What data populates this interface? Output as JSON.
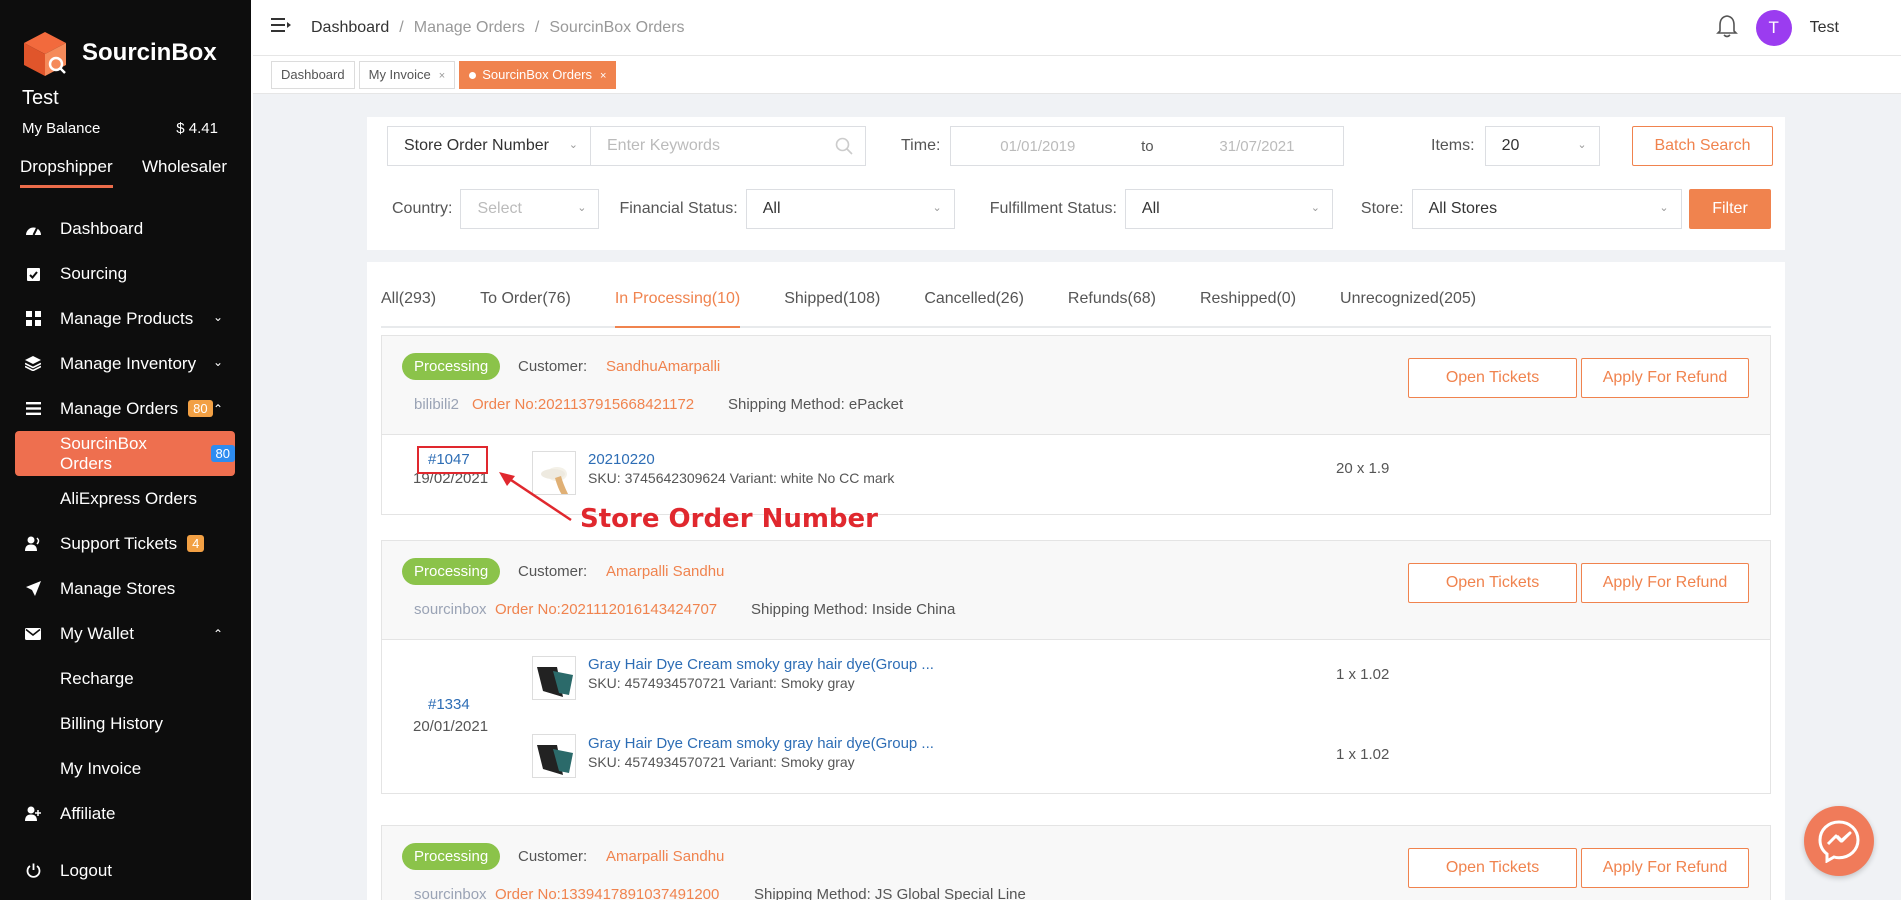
{
  "sidebar": {
    "brand": "SourcinBox",
    "user_name": "Test",
    "balance_label": "My Balance",
    "balance_value": "$ 4.41",
    "roles": [
      "Dropshipper",
      "Wholesaler"
    ],
    "items": [
      {
        "label": "Dashboard",
        "icon": "dashboard-icon"
      },
      {
        "label": "Sourcing",
        "icon": "sourcing-icon"
      },
      {
        "label": "Manage Products",
        "icon": "grid-icon"
      },
      {
        "label": "Manage Inventory",
        "icon": "layers-icon"
      },
      {
        "label": "Manage Orders",
        "icon": "list-icon",
        "badge": "80"
      },
      {
        "label": "SourcinBox Orders",
        "badge": "80"
      },
      {
        "label": "AliExpress Orders"
      },
      {
        "label": "Support Tickets",
        "icon": "support-icon",
        "badge": "4"
      },
      {
        "label": "Manage Stores",
        "icon": "send-icon"
      },
      {
        "label": "My Wallet",
        "icon": "mail-icon"
      },
      {
        "label": "Recharge"
      },
      {
        "label": "Billing History"
      },
      {
        "label": "My Invoice"
      },
      {
        "label": "Affiliate",
        "icon": "affiliate-icon"
      },
      {
        "label": "Logout",
        "icon": "power-icon"
      }
    ]
  },
  "header": {
    "breadcrumb": [
      "Dashboard",
      "Manage Orders",
      "SourcinBox Orders"
    ],
    "user": "Test",
    "avatar_letter": "T"
  },
  "page_tabs": [
    {
      "label": "Dashboard"
    },
    {
      "label": "My Invoice",
      "close": "×"
    },
    {
      "label": "SourcinBox Orders",
      "close": "×"
    }
  ],
  "filters": {
    "order_type": "Store Order Number",
    "keyword_placeholder": "Enter Keywords",
    "time_label": "Time:",
    "date_from": "01/01/2019",
    "date_to_label": "to",
    "date_to": "31/07/2021",
    "items_label": "Items:",
    "items_value": "20",
    "batch_search": "Batch Search",
    "country_label": "Country:",
    "country_placeholder": "Select",
    "financial_label": "Financial Status:",
    "financial_value": "All",
    "fulfillment_label": "Fulfillment Status:",
    "fulfillment_value": "All",
    "store_label": "Store:",
    "store_value": "All Stores",
    "filter_button": "Filter"
  },
  "status_tabs": [
    "All(293)",
    "To Order(76)",
    "In Processing(10)",
    "Shipped(108)",
    "Cancelled(26)",
    "Refunds(68)",
    "Reshipped(0)",
    "Unrecognized(205)"
  ],
  "orders": [
    {
      "status": "Processing",
      "customer_label": "Customer:",
      "customer": "SandhuAmarpalli",
      "store": "bilibili2",
      "order_no": "Order No:202113791566842117​2",
      "shipping": "Shipping Method: ePacket",
      "open_tickets": "Open Tickets",
      "apply_refund": "Apply For Refund",
      "number": "#1047",
      "date": "19/02/2021",
      "items": [
        {
          "title": "20210220",
          "sku": "SKU: 3745642309624  Variant: white No CC mark",
          "qty": "20 x 1.9"
        }
      ]
    },
    {
      "status": "Processing",
      "customer_label": "Customer:",
      "customer": "Amarpalli Sandhu",
      "store": "sourcinbox",
      "order_no": "Order No:2021112016143424707",
      "shipping": "Shipping Method: Inside China",
      "open_tickets": "Open Tickets",
      "apply_refund": "Apply For Refund",
      "number": "#1334",
      "date": "20/01/2021",
      "items": [
        {
          "title": "Gray Hair Dye Cream smoky gray hair dye(Group ...",
          "sku": "SKU: 4574934570721  Variant: Smoky gray",
          "qty": "1 x 1.02"
        },
        {
          "title": "Gray Hair Dye Cream smoky gray hair dye(Group ...",
          "sku": "SKU: 4574934570721  Variant: Smoky gray",
          "qty": "1 x 1.02"
        }
      ]
    },
    {
      "status": "Processing",
      "customer_label": "Customer:",
      "customer": "Amarpalli Sandhu",
      "store": "sourcinbox",
      "order_no": "Order No:1339417891037491200",
      "shipping": "Shipping Method: JS Global Special Line",
      "open_tickets": "Open Tickets",
      "apply_refund": "Apply For Refund"
    }
  ],
  "annotation": "Store Order Number",
  "colors": {
    "accent": "#f0834e",
    "sidebar_bg": "#0d0d0d",
    "processing": "#8bc34a",
    "link": "#2d6db5"
  }
}
